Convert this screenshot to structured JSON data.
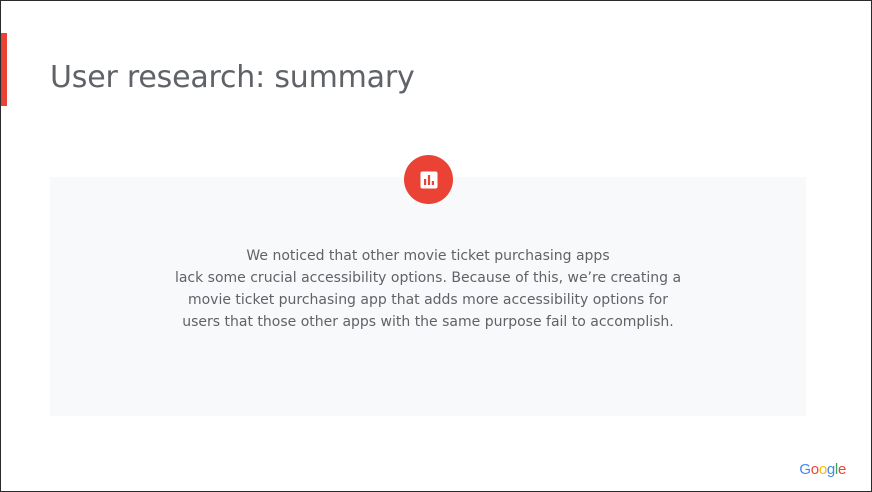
{
  "slide": {
    "title": "User research: summary",
    "summary_lines": [
      "We noticed that other movie ticket purchasing apps",
      "lack some crucial accessibility options. Because of this, we’re creating a",
      "movie ticket purchasing app that adds more accessibility options for",
      "users that those other apps with the same purpose fail to accomplish."
    ],
    "badge_icon": "bar-chart-icon",
    "logo_text": "Google"
  },
  "colors": {
    "accent": "#ea4335",
    "title_text": "#5f6368",
    "panel_background": "#f8f9fa",
    "logo_blue": "#4285f4",
    "logo_red": "#ea4335",
    "logo_yellow": "#fbbc05",
    "logo_green": "#34a853"
  }
}
